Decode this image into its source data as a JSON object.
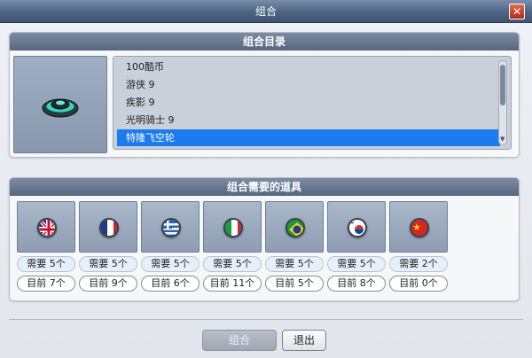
{
  "window": {
    "title": "组合"
  },
  "catalog": {
    "header": "组合目录",
    "items": [
      {
        "label": "100酷币"
      },
      {
        "label": "游侠 9"
      },
      {
        "label": "疾影 9"
      },
      {
        "label": "光明骑士 9"
      },
      {
        "label": "特隆飞空轮",
        "selected": true
      }
    ]
  },
  "requirements": {
    "header": "组合需要的道具",
    "items": [
      {
        "icon": "uk-flag-icon",
        "need": "需要 5个",
        "have": "目前 7个"
      },
      {
        "icon": "france-flag-icon",
        "need": "需要 5个",
        "have": "目前 9个"
      },
      {
        "icon": "greece-flag-icon",
        "need": "需要 5个",
        "have": "目前 6个"
      },
      {
        "icon": "italy-flag-icon",
        "need": "需要 5个",
        "have": "目前 11个"
      },
      {
        "icon": "brazil-flag-icon",
        "need": "需要 5个",
        "have": "目前 5个"
      },
      {
        "icon": "korea-flag-icon",
        "need": "需要 5个",
        "have": "目前 8个"
      },
      {
        "icon": "china-flag-icon",
        "need": "需要 2个",
        "have": "目前 0个"
      }
    ]
  },
  "buttons": {
    "combine": "组合",
    "exit": "退出"
  },
  "colors": {
    "selected": "#1a7cf0",
    "header": "#55667f"
  }
}
